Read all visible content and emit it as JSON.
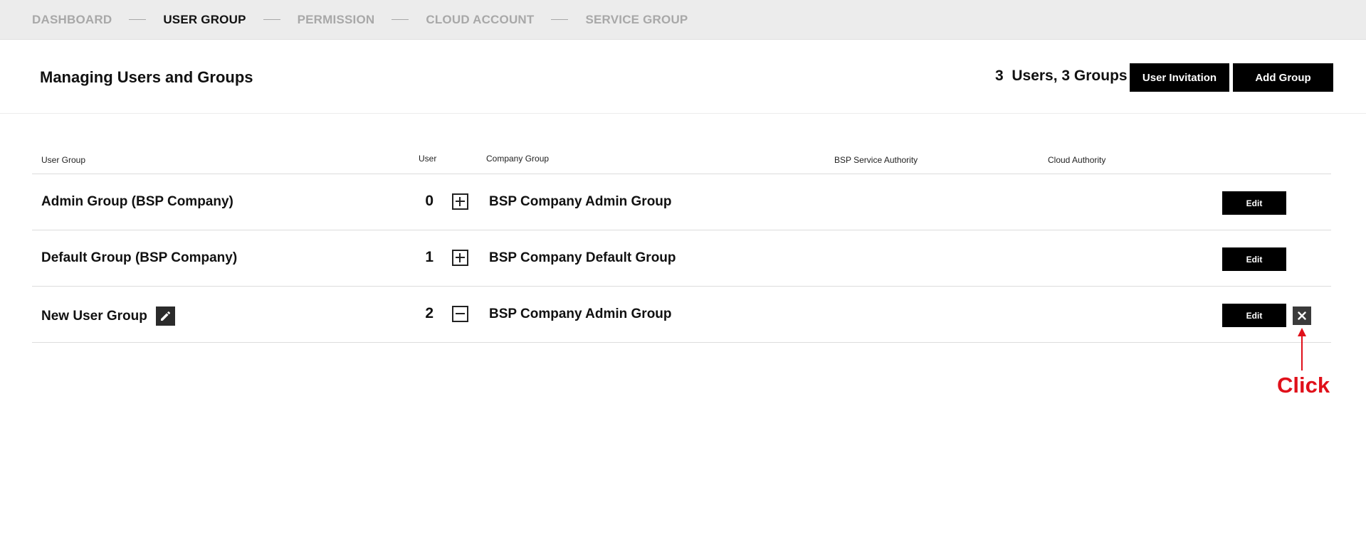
{
  "nav": {
    "steps": [
      {
        "label": "DASHBOARD",
        "active": false
      },
      {
        "label": "USER GROUP",
        "active": true
      },
      {
        "label": "PERMISSION",
        "active": false
      },
      {
        "label": "CLOUD ACCOUNT",
        "active": false
      },
      {
        "label": "SERVICE GROUP",
        "active": false
      }
    ]
  },
  "header": {
    "title": "Managing Users and Groups",
    "summary": "3  Users, 3 Groups",
    "invite_label": "User Invitation",
    "add_label": "Add Group"
  },
  "table": {
    "columns": {
      "group": "User Group",
      "user": "User",
      "company": "Company Group",
      "bsp": "BSP Service Authority",
      "cloud": "Cloud Authority"
    },
    "rows": [
      {
        "name": "Admin Group (BSP Company)",
        "count": "0",
        "toggle": "plus",
        "company": "BSP Company Admin Group",
        "edit_label": "Edit",
        "renamable": false,
        "deletable": false
      },
      {
        "name": "Default Group (BSP Company)",
        "count": "1",
        "toggle": "plus",
        "company": "BSP Company Default Group",
        "edit_label": "Edit",
        "renamable": false,
        "deletable": false
      },
      {
        "name": "New User Group",
        "count": "2",
        "toggle": "minus",
        "company": "BSP Company Admin Group",
        "edit_label": "Edit",
        "renamable": true,
        "deletable": true
      }
    ]
  },
  "annotation": {
    "label": "Click",
    "color": "#e0101a"
  },
  "colors": {
    "nav_background": "#ececec",
    "nav_inactive": "#a8a8a8",
    "button": "#000000"
  }
}
